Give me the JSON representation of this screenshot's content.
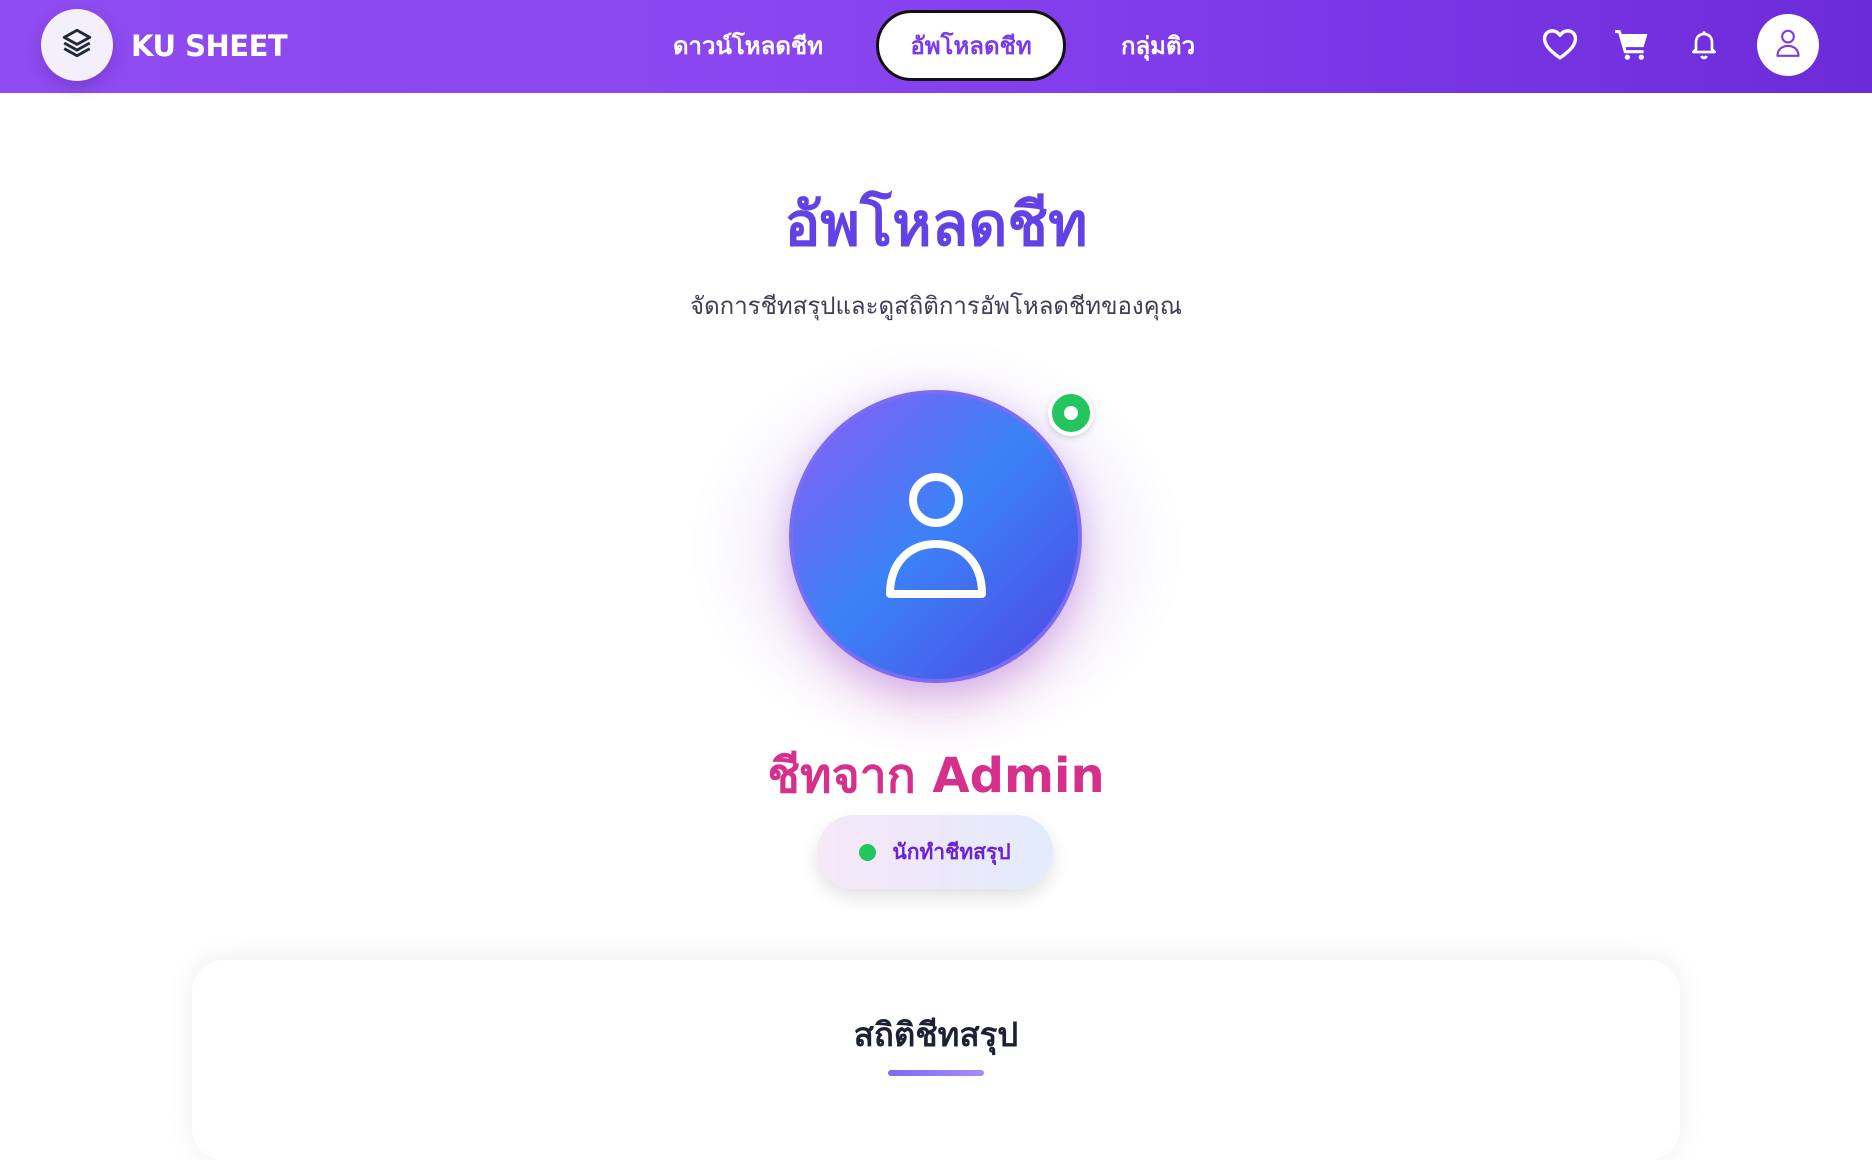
{
  "brand": {
    "name": "KU SHEET",
    "logo_icon": "stacked-layers-icon"
  },
  "nav": {
    "links": [
      {
        "label": "ดาวน์โหลดชีท"
      },
      {
        "label": "อัพโหลดชีท",
        "active": true
      },
      {
        "label": "กลุ่มติว"
      }
    ],
    "icons": [
      "heart-icon",
      "cart-icon",
      "bell-icon",
      "user-icon"
    ]
  },
  "page": {
    "title": "อัพโหลดชีท",
    "subtitle": "จัดการชีทสรุปและดูสถิติการอัพโหลดชีทของคุณ"
  },
  "profile": {
    "avatar_icon": "user-icon",
    "online": true,
    "name": "ชีทจาก Admin",
    "role": "นักทำชีทสรุป"
  },
  "stats": {
    "title": "สถิติชีทสรุป"
  },
  "colors": {
    "navbar_start": "#8f4cf0",
    "navbar_end": "#6c2bd9",
    "title": "#6241e5",
    "name": "#d5308c",
    "online": "#22c55e",
    "role_text": "#6a22d0"
  }
}
